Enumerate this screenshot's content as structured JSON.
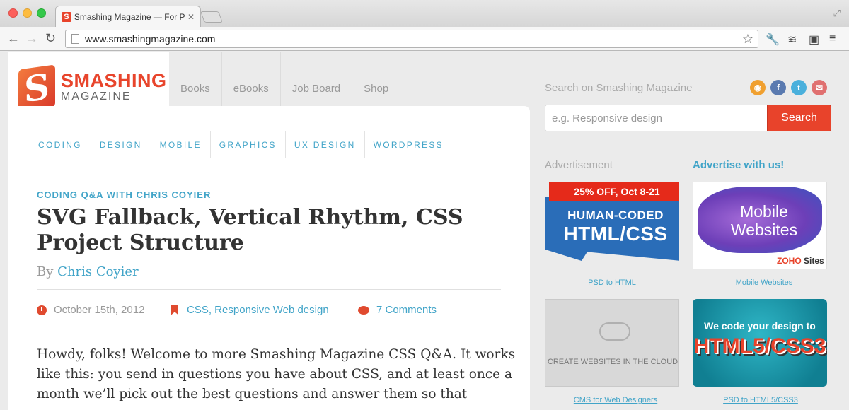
{
  "browser": {
    "tab_title": "Smashing Magazine — For Pr",
    "tab_favicon": "S",
    "url": "www.smashingmagazine.com"
  },
  "site": {
    "logo_word": "SMASHING",
    "logo_sub": "MAGAZINE",
    "logo_mark": "S",
    "topnav": [
      "Books",
      "eBooks",
      "Job Board",
      "Shop"
    ],
    "categories": [
      "CODING",
      "DESIGN",
      "MOBILE",
      "GRAPHICS",
      "UX DESIGN",
      "WORDPRESS"
    ]
  },
  "article": {
    "kicker": "CODING Q&A WITH CHRIS COYIER",
    "title": "SVG Fallback, Vertical Rhythm, CSS Project Structure",
    "by": "By",
    "author": "Chris Coyier",
    "date": "October 15th, 2012",
    "tags": "CSS, Responsive Web design",
    "comments": "7 Comments",
    "body": "Howdy, folks! Welcome to more Smashing Magazine CSS Q&A. It works like this: you send in questions you have about CSS, and at least once a month we’ll pick out the best questions and answer them so that everyone"
  },
  "sidebar": {
    "search_label": "Search on Smashing Magazine",
    "search_placeholder": "e.g. Responsive design",
    "search_button": "Search",
    "ad_label": "Advertisement",
    "advertise_link": "Advertise with us!",
    "social": [
      "rss-icon",
      "facebook-icon",
      "twitter-icon",
      "email-icon"
    ],
    "ads": [
      {
        "ribbon": "25% OFF, Oct 8-21",
        "line1": "HUMAN-CODED",
        "line2": "HTML/CSS",
        "caption": "PSD to HTML"
      },
      {
        "line1": "Mobile",
        "line2": "Websites",
        "brand": "ZOHO",
        "brand_suffix": "Sites",
        "caption": "Mobile Websites"
      },
      {
        "text": "CREATE WEBSITES IN THE CLOUD",
        "caption": "CMS for Web Designers"
      },
      {
        "line1": "We code your design to",
        "line2": "HTML5/CSS3",
        "caption": "PSD to HTML5/CSS3"
      }
    ]
  },
  "colors": {
    "accent": "#e8432b",
    "link": "#41a4c8"
  }
}
